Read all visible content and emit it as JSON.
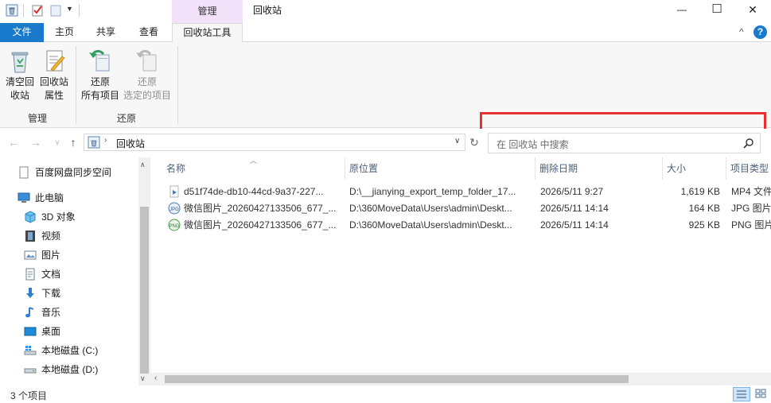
{
  "titlebar": {
    "context_tab_label": "管理",
    "title": "回收站",
    "minimize_glyph": "—",
    "maximize_glyph": "☐",
    "close_glyph": "✕"
  },
  "ribbon_tabs": {
    "file": "文件",
    "home": "主页",
    "share": "共享",
    "view": "查看",
    "recycle_tools": "回收站工具",
    "help_glyph": "?",
    "collapse_glyph": "^"
  },
  "ribbon": {
    "empty_bin": [
      "清空回",
      "收站"
    ],
    "bin_properties": [
      "回收站",
      "属性"
    ],
    "manage_group": "管理",
    "restore_all": [
      "还原",
      "所有项目"
    ],
    "restore_selected": [
      "还原",
      "选定的项目"
    ],
    "restore_group": "还原"
  },
  "address": {
    "path": "回收站",
    "search_placeholder": "在 回收站 中搜索"
  },
  "nav": {
    "items": [
      {
        "label": "百度网盘同步空间",
        "icon": "document-icon"
      },
      {
        "label": "此电脑",
        "icon": "computer-icon"
      },
      {
        "label": "3D 对象",
        "icon": "cube-icon"
      },
      {
        "label": "视频",
        "icon": "film-icon"
      },
      {
        "label": "图片",
        "icon": "picture-icon"
      },
      {
        "label": "文档",
        "icon": "document-icon"
      },
      {
        "label": "下载",
        "icon": "download-icon"
      },
      {
        "label": "音乐",
        "icon": "music-icon"
      },
      {
        "label": "桌面",
        "icon": "desktop-icon"
      },
      {
        "label": "本地磁盘 (C:)",
        "icon": "windows-drive-icon"
      },
      {
        "label": "本地磁盘 (D:)",
        "icon": "drive-icon"
      }
    ]
  },
  "columns": {
    "name": "名称",
    "original_location": "原位置",
    "date_deleted": "删除日期",
    "size": "大小",
    "type": "项目类型"
  },
  "files": [
    {
      "name": "d51f74de-db10-44cd-9a37-227...",
      "location": "D:\\__jianying_export_temp_folder_17...",
      "date": "2026/5/11 9:27",
      "size": "1,619 KB",
      "type": "MP4 文件",
      "icon": "video-file-icon"
    },
    {
      "name": "微信图片_20260427133506_677_...",
      "location": "D:\\360MoveData\\Users\\admin\\Deskt...",
      "date": "2026/5/11 14:14",
      "size": "164 KB",
      "type": "JPG 图片文件",
      "icon": "jpg-file-icon"
    },
    {
      "name": "微信图片_20260427133506_677_...",
      "location": "D:\\360MoveData\\Users\\admin\\Deskt...",
      "date": "2026/5/11 14:14",
      "size": "925 KB",
      "type": "PNG 图片文件",
      "icon": "png-file-icon"
    }
  ],
  "status": {
    "item_count": "3 个项目"
  },
  "colors": {
    "file_tab": "#1979ca",
    "context_tab": "#f2e2f9",
    "highlight_box": "#e83030",
    "header_text": "#4c607a"
  }
}
